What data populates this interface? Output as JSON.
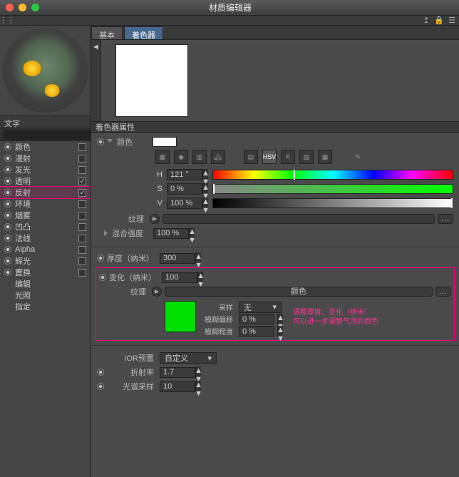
{
  "window": {
    "title": "材质编辑器"
  },
  "leftPanel": {
    "folderLabel": "文字",
    "channels": [
      {
        "label": "颜色",
        "radio": true,
        "check": false,
        "sel": false
      },
      {
        "label": "漫射",
        "radio": true,
        "check": false,
        "sel": false
      },
      {
        "label": "发光",
        "radio": true,
        "check": false,
        "sel": false
      },
      {
        "label": "透明",
        "radio": true,
        "check": true,
        "sel": false
      },
      {
        "label": "反射",
        "radio": true,
        "check": true,
        "sel": true
      },
      {
        "label": "环境",
        "radio": true,
        "check": false,
        "sel": false
      },
      {
        "label": "烟雾",
        "radio": true,
        "check": false,
        "sel": false
      },
      {
        "label": "凹凸",
        "radio": true,
        "check": false,
        "sel": false
      },
      {
        "label": "法线",
        "radio": true,
        "check": false,
        "sel": false
      },
      {
        "label": "Alpha",
        "radio": true,
        "check": false,
        "sel": false
      },
      {
        "label": "辉光",
        "radio": true,
        "check": false,
        "sel": false
      },
      {
        "label": "置换",
        "radio": true,
        "check": false,
        "sel": false
      },
      {
        "label": "编辑",
        "radio": false,
        "check": null,
        "sel": false
      },
      {
        "label": "光照",
        "radio": false,
        "check": null,
        "sel": false
      },
      {
        "label": "指定",
        "radio": false,
        "check": null,
        "sel": false
      }
    ]
  },
  "tabs": {
    "basic": "基本",
    "shader": "着色器"
  },
  "shader": {
    "propsHeader": "着色器属性",
    "colorLabel": "颜色",
    "h": {
      "label": "H",
      "value": "121 °"
    },
    "s": {
      "label": "S",
      "value": "0 %"
    },
    "v": {
      "label": "V",
      "value": "100 %"
    },
    "textureLabel": "纹理",
    "mixLabel": "混合强度",
    "mixValue": "100 %",
    "thickLabel": "厚度（纳米）",
    "thickValue": "300",
    "varyLabel": "变化（纳米）",
    "varyValue": "100",
    "tex2Label": "纹理",
    "tex2Bar": "颜色",
    "sample": {
      "label": "采样",
      "value": "无"
    },
    "blurOffset": {
      "label": "模糊偏移",
      "value": "0 %"
    },
    "blurAmount": {
      "label": "模糊程度",
      "value": "0 %"
    },
    "annot1": "调整厚度、变化（纳米）",
    "annot2": "可以进一步调整气泡的颜色",
    "iorPresetLabel": "IOR预置",
    "iorPresetValue": "自定义",
    "iorLabel": "折射率",
    "iorValue": "1.7",
    "specSampleLabel": "光谱采样",
    "specSampleValue": "10",
    "dots": "...",
    "hsvBtn": "HSV"
  }
}
